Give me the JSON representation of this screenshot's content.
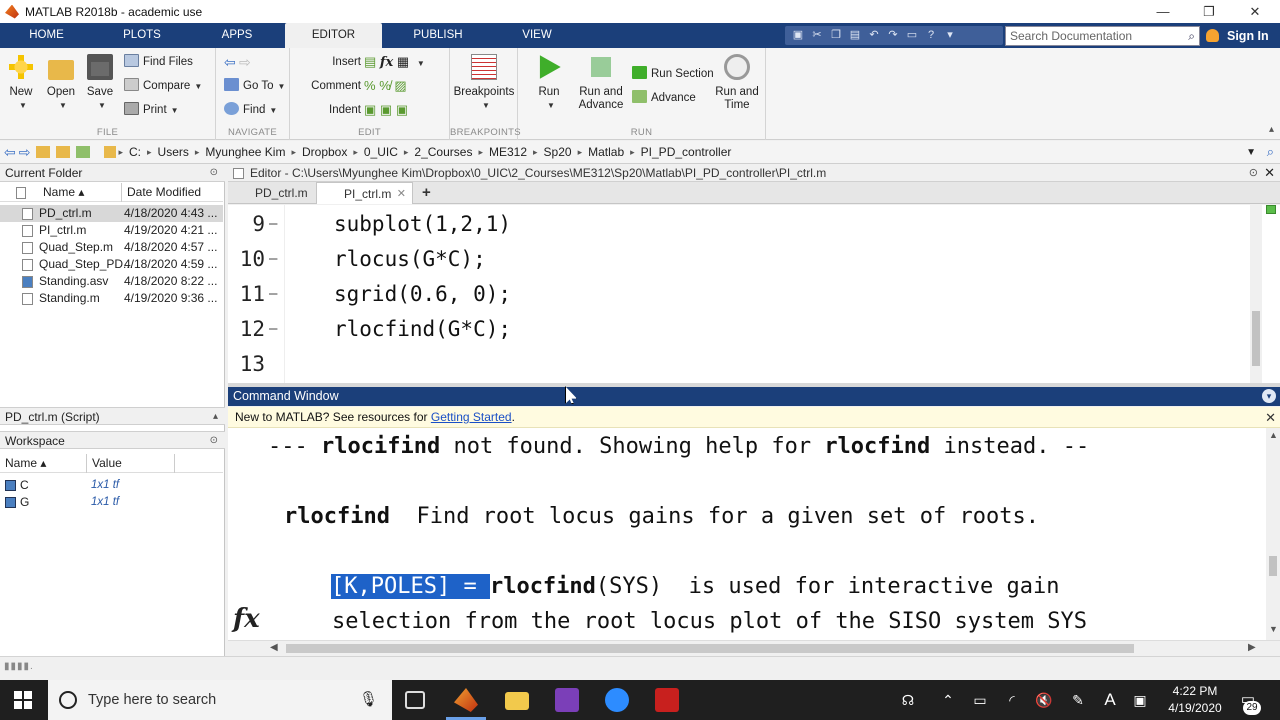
{
  "window": {
    "title": "MATLAB R2018b - academic use",
    "min": "—",
    "max": "❐",
    "close": "✕"
  },
  "tabs": [
    "HOME",
    "PLOTS",
    "APPS",
    "EDITOR",
    "PUBLISH",
    "VIEW"
  ],
  "active_tab": "EDITOR",
  "search": {
    "placeholder": "Search Documentation"
  },
  "signin": "Sign In",
  "ribbon": {
    "file": {
      "label": "FILE",
      "new": "New",
      "open": "Open",
      "save": "Save",
      "find_files": "Find Files",
      "compare": "Compare",
      "print": "Print"
    },
    "navigate": {
      "label": "NAVIGATE",
      "goto": "Go To",
      "find": "Find"
    },
    "edit": {
      "label": "EDIT",
      "insert": "Insert",
      "comment": "Comment",
      "indent": "Indent"
    },
    "breakpoints": {
      "label": "BREAKPOINTS",
      "btn": "Breakpoints"
    },
    "run": {
      "label": "RUN",
      "run": "Run",
      "run_advance": "Run and Advance",
      "run_section": "Run Section",
      "advance": "Advance",
      "run_time": "Run and Time"
    }
  },
  "address": [
    "C:",
    "Users",
    "Myunghee Kim",
    "Dropbox",
    "0_UIC",
    "2_Courses",
    "ME312",
    "Sp20",
    "Matlab",
    "PI_PD_controller"
  ],
  "current_folder": {
    "title": "Current Folder",
    "col_name": "Name ▴",
    "col_date": "Date Modified",
    "files": [
      {
        "name": "PD_ctrl.m",
        "date": "4/18/2020 4:43 ..."
      },
      {
        "name": "PI_ctrl.m",
        "date": "4/19/2020 4:21 ..."
      },
      {
        "name": "Quad_Step.m",
        "date": "4/18/2020 4:57 ..."
      },
      {
        "name": "Quad_Step_PD...",
        "date": "4/18/2020 4:59 ..."
      },
      {
        "name": "Standing.asv",
        "date": "4/18/2020 8:22 ..."
      },
      {
        "name": "Standing.m",
        "date": "4/19/2020 9:36 ..."
      }
    ]
  },
  "details": {
    "title": "PD_ctrl.m  (Script)"
  },
  "workspace": {
    "title": "Workspace",
    "col_name": "Name ▴",
    "col_value": "Value",
    "vars": [
      {
        "name": "C",
        "value": "1x1 tf"
      },
      {
        "name": "G",
        "value": "1x1 tf"
      }
    ]
  },
  "editor": {
    "header": "Editor - C:\\Users\\Myunghee Kim\\Dropbox\\0_UIC\\2_Courses\\ME312\\Sp20\\Matlab\\PI_PD_controller\\PI_ctrl.m",
    "tabs": [
      "PD_ctrl.m",
      "PI_ctrl.m"
    ],
    "add_tab": "+",
    "lines": [
      {
        "num": "9",
        "code": "subplot(1,2,1)"
      },
      {
        "num": "10",
        "code": "rlocus(G*C);"
      },
      {
        "num": "11",
        "code": "sgrid(0.6, 0);"
      },
      {
        "num": "12",
        "code": "rlocfind(G*C);"
      },
      {
        "num": "13",
        "code": ""
      }
    ]
  },
  "command_window": {
    "title": "Command Window",
    "info_prefix": "New to MATLAB? See resources for ",
    "info_link": "Getting Started",
    "info_suffix": ".",
    "l1a": "--- ",
    "l1b": "rlocifind",
    "l1c": " not found. Showing help for ",
    "l1d": "rlocfind",
    "l1e": " instead. --",
    "l2a": "rlocfind",
    "l2b": "  Find root locus gains for a given set of roots.",
    "l3a": "[K,POLES] = ",
    "l3b": "rlocfind",
    "l3c": "(SYS)  is used for interactive gain",
    "l4": "selection from the root locus plot of the SISO system SYS",
    "fx": "fx"
  },
  "taskbar": {
    "search_placeholder": "Type here to search",
    "time": "4:22 PM",
    "date": "4/19/2020",
    "notif_count": "29",
    "lang": "A"
  }
}
